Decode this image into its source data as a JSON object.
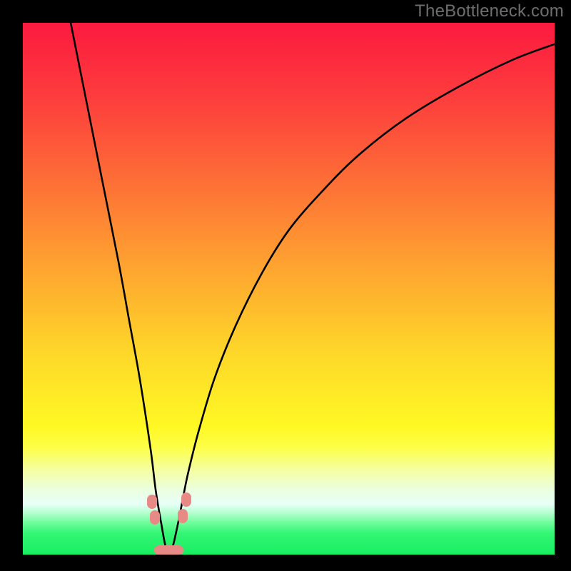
{
  "watermark": "TheBottleneck.com",
  "frame": {
    "outer_size": 800,
    "border_top": 32,
    "border_left": 32,
    "border_right": 23,
    "border_bottom": 23,
    "border_color": "#000000"
  },
  "gradient_stops": [
    {
      "pct": 0,
      "color": "#fc1a3f"
    },
    {
      "pct": 14,
      "color": "#fd3d3d"
    },
    {
      "pct": 30,
      "color": "#fd6f36"
    },
    {
      "pct": 46,
      "color": "#fea430"
    },
    {
      "pct": 62,
      "color": "#fed729"
    },
    {
      "pct": 72,
      "color": "#feef26"
    },
    {
      "pct": 76,
      "color": "#fff824"
    },
    {
      "pct": 80,
      "color": "#fdff4a"
    },
    {
      "pct": 84,
      "color": "#f5ffa0"
    },
    {
      "pct": 88,
      "color": "#ebffe2"
    },
    {
      "pct": 90.5,
      "color": "#e7fff7"
    },
    {
      "pct": 92,
      "color": "#bbffd2"
    },
    {
      "pct": 94,
      "color": "#70fd9c"
    },
    {
      "pct": 96,
      "color": "#33f674"
    },
    {
      "pct": 100,
      "color": "#18ee62"
    }
  ],
  "chart_data": {
    "type": "line",
    "title": "",
    "xlabel": "",
    "ylabel": "",
    "xlim": [
      0,
      100
    ],
    "ylim": [
      0,
      100
    ],
    "note": "Bottleneck-percentage style V curve. y≈100 is top (red/bad), y≈0 is bottom (green/good). Minimum around x≈27 where y≈0.",
    "series": [
      {
        "name": "bottleneck-curve",
        "x": [
          9,
          12,
          15,
          18,
          20,
          22,
          24,
          25,
          26,
          27,
          28,
          29,
          30,
          31,
          33,
          36,
          40,
          45,
          50,
          56,
          63,
          72,
          82,
          92,
          100
        ],
        "y": [
          100,
          85,
          70,
          55,
          44,
          33,
          20,
          12,
          6,
          1,
          1,
          5,
          10,
          15,
          23,
          33,
          43,
          53,
          61,
          68,
          75,
          82,
          88,
          93,
          96
        ]
      }
    ],
    "markers": [
      {
        "name": "left-dot-upper",
        "x": 24.3,
        "y": 10.0
      },
      {
        "name": "left-dot-lower",
        "x": 24.8,
        "y": 7.0
      },
      {
        "name": "right-dot-upper",
        "x": 30.7,
        "y": 10.3
      },
      {
        "name": "right-dot-lower",
        "x": 30.1,
        "y": 7.3
      },
      {
        "name": "bottom-bar",
        "x": 27.5,
        "y": 0.8,
        "w": 5.5,
        "h": 2.0
      }
    ]
  }
}
